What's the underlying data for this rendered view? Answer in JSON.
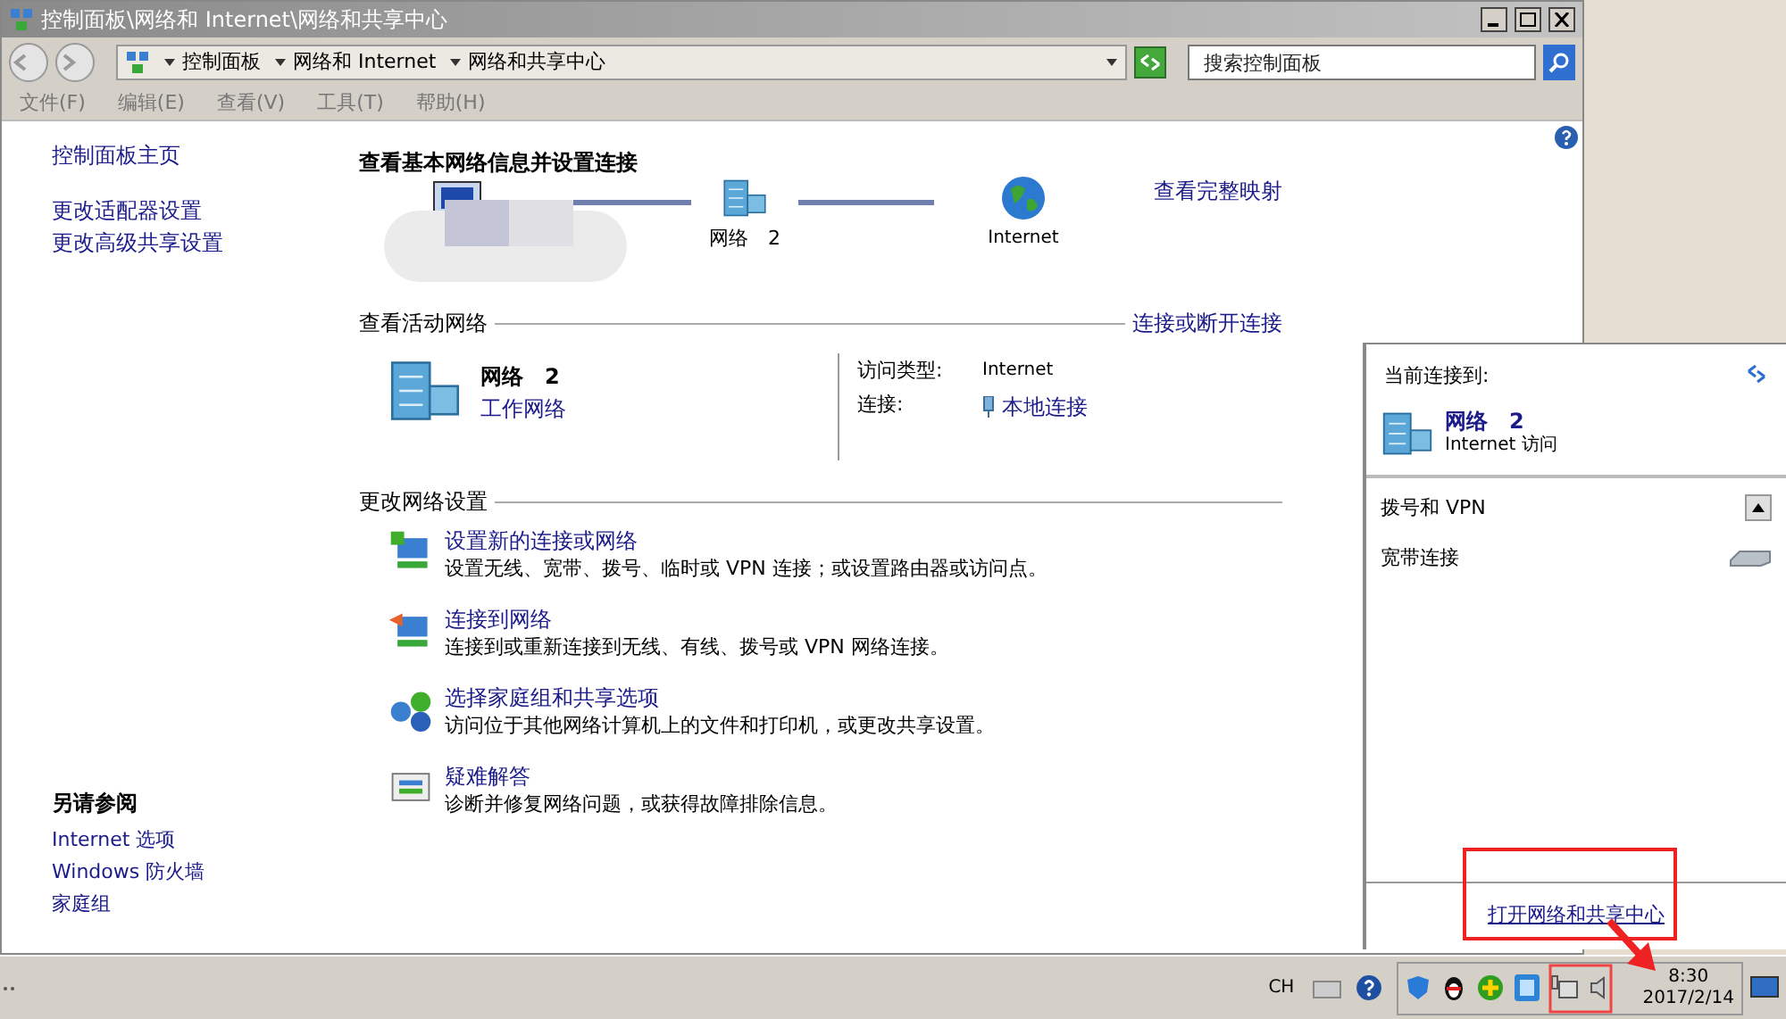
{
  "window": {
    "title": "控制面板\\网络和 Internet\\网络和共享中心"
  },
  "address": {
    "crumbs": [
      "控制面板",
      "网络和 Internet",
      "网络和共享中心"
    ],
    "search_placeholder": "搜索控制面板"
  },
  "menu": [
    "文件(F)",
    "编辑(E)",
    "查看(V)",
    "工具(T)",
    "帮助(H)"
  ],
  "sidebar": {
    "links": [
      {
        "label": "控制面板主页"
      },
      {
        "label": "更改适配器设置"
      },
      {
        "label": "更改高级共享设置"
      }
    ],
    "see_also": {
      "title": "另请参阅",
      "links": [
        "Internet 选项",
        "Windows 防火墙",
        "家庭组"
      ]
    }
  },
  "main": {
    "heading": "查看基本网络信息并设置连接",
    "map_link": "查看完整映射",
    "map_nodes": [
      "网络　2",
      "Internet"
    ],
    "active_section": "查看活动网络",
    "connect_link": "连接或断开连接",
    "network": {
      "name": "网络　2",
      "type_link": "工作网络",
      "access_label": "访问类型:",
      "access_value": "Internet",
      "conn_label": "连接:",
      "conn_link": "本地连接"
    },
    "change_section": "更改网络设置",
    "tasks": [
      {
        "kind": "new",
        "title": "设置新的连接或网络",
        "desc": "设置无线、宽带、拨号、临时或 VPN 连接；或设置路由器或访问点。"
      },
      {
        "kind": "connect",
        "title": "连接到网络",
        "desc": "连接到或重新连接到无线、有线、拨号或 VPN 网络连接。"
      },
      {
        "kind": "homegroup",
        "title": "选择家庭组和共享选项",
        "desc": "访问位于其他网络计算机上的文件和打印机，或更改共享设置。"
      },
      {
        "kind": "troubleshoot",
        "title": "疑难解答",
        "desc": "诊断并修复网络问题，或获得故障排除信息。"
      }
    ]
  },
  "popup": {
    "header": "当前连接到:",
    "network": "网络　2",
    "access": "Internet 访问",
    "group": "拨号和 VPN",
    "group_expanded": true,
    "item": "宽带连接",
    "footer_link": "打开网络和共享中心"
  },
  "taskbar": {
    "lang": "CH",
    "time": "8:30",
    "date": "2017/2/14"
  }
}
